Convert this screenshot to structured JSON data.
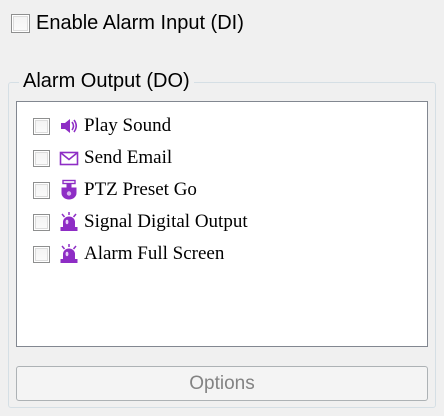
{
  "enable_alarm_input": {
    "label": "Enable Alarm Input (DI)",
    "checked": false
  },
  "alarm_output": {
    "title": "Alarm Output (DO)",
    "items": [
      {
        "label": "Play Sound",
        "checked": false,
        "icon": "speaker-icon"
      },
      {
        "label": "Send Email",
        "checked": false,
        "icon": "envelope-icon"
      },
      {
        "label": "PTZ Preset Go",
        "checked": false,
        "icon": "ptz-camera-icon"
      },
      {
        "label": "Signal Digital Output",
        "checked": false,
        "icon": "alarm-siren-icon"
      },
      {
        "label": "Alarm Full Screen",
        "checked": false,
        "icon": "alarm-siren-icon"
      }
    ]
  },
  "options_button": {
    "label": "Options",
    "enabled": false
  },
  "colors": {
    "icon_accent": "#8e2dc5",
    "disabled_text": "#838383"
  }
}
